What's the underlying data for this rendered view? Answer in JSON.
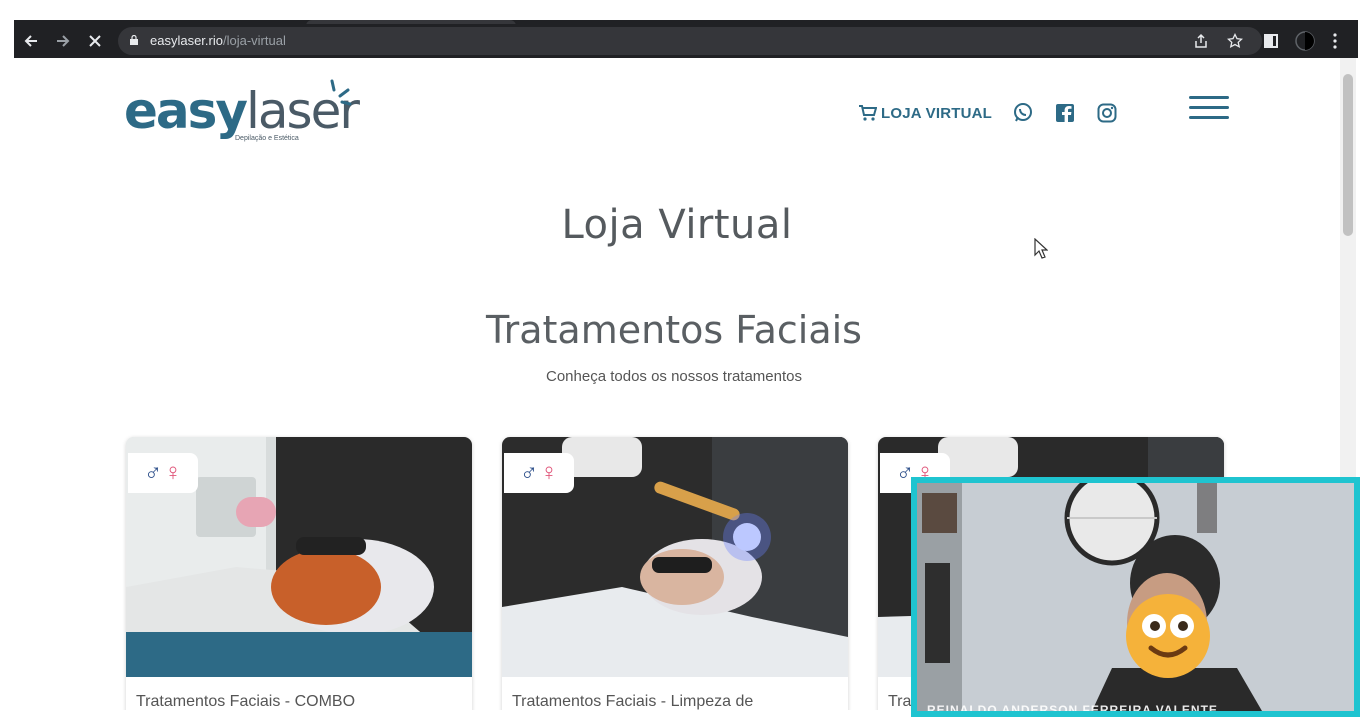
{
  "browser": {
    "url_host": "easylaser.rio",
    "url_path": "/loja-virtual",
    "back_icon": "arrow-left-icon",
    "forward_icon": "arrow-right-icon",
    "stop_icon": "close-icon"
  },
  "site": {
    "logo_word_1": "easy",
    "logo_word_2": "laser",
    "logo_tagline": "Depilação e Estética",
    "nav_shop_label": "LOJA VIRTUAL",
    "brand_color": "#2d6a86"
  },
  "page": {
    "title": "Loja Virtual",
    "section_title": "Tratamentos Faciais",
    "section_subtitle": "Conheça todos os nossos tratamentos"
  },
  "products": [
    {
      "title": "Tratamentos Faciais - COMBO",
      "gender_icons": "♂♀"
    },
    {
      "title": "Tratamentos Faciais - Limpeza de",
      "gender_icons": "♂♀"
    },
    {
      "title": "Tra",
      "gender_icons": "♂♀"
    }
  ],
  "webcam": {
    "participant_name": "REINALDO ANDERSON FERREIRA VALENTE",
    "border_color": "#1fc4d0"
  }
}
